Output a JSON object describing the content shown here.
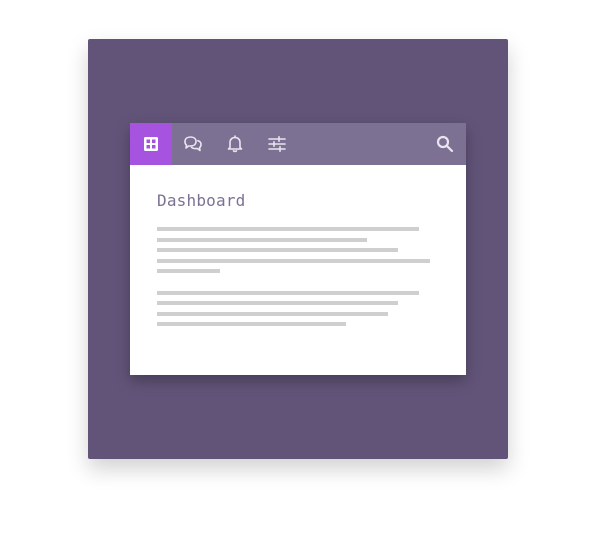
{
  "navbar": {
    "items": [
      {
        "icon": "dashboard-grid-icon",
        "active": true
      },
      {
        "icon": "chat-bubbles-icon",
        "active": false
      },
      {
        "icon": "bell-icon",
        "active": false
      },
      {
        "icon": "sliders-icon",
        "active": false
      }
    ],
    "search_icon": "search-icon",
    "active_color": "#a654e0",
    "bar_color": "#7c7193"
  },
  "main": {
    "title": "Dashboard"
  },
  "colors": {
    "background": "#625479",
    "card": "#ffffff",
    "placeholder_line": "#cfcfcf"
  }
}
